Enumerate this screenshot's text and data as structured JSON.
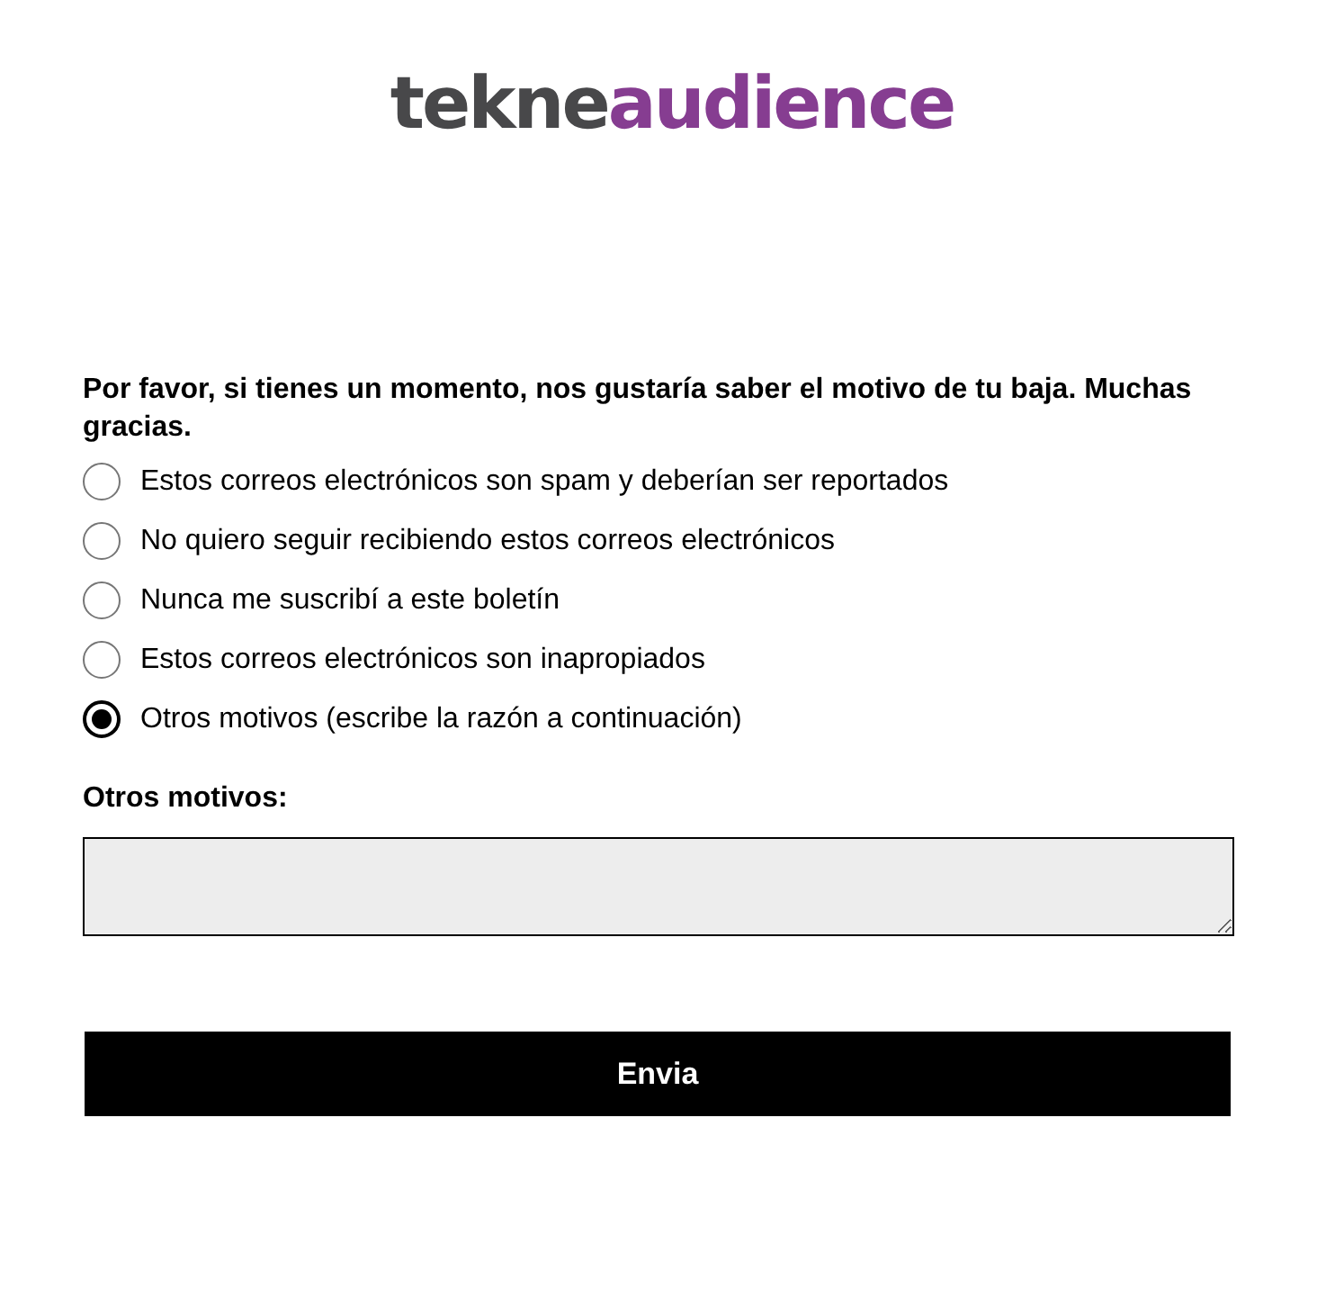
{
  "logo": {
    "first": "tekne",
    "second": "audience"
  },
  "question": "Por favor, si tienes un momento, nos gustaría saber el motivo de tu baja. Muchas gracias.",
  "options": [
    {
      "label": "Estos correos electrónicos son spam y deberían ser reportados",
      "selected": false
    },
    {
      "label": "No quiero seguir recibiendo estos correos electrónicos",
      "selected": false
    },
    {
      "label": "Nunca me suscribí a este boletín",
      "selected": false
    },
    {
      "label": "Estos correos electrónicos son inapropiados",
      "selected": false
    },
    {
      "label": "Otros motivos (escribe la razón a continuación)",
      "selected": true
    }
  ],
  "other_reasons": {
    "label": "Otros motivos:"
  },
  "submit": {
    "label": "Envia"
  }
}
